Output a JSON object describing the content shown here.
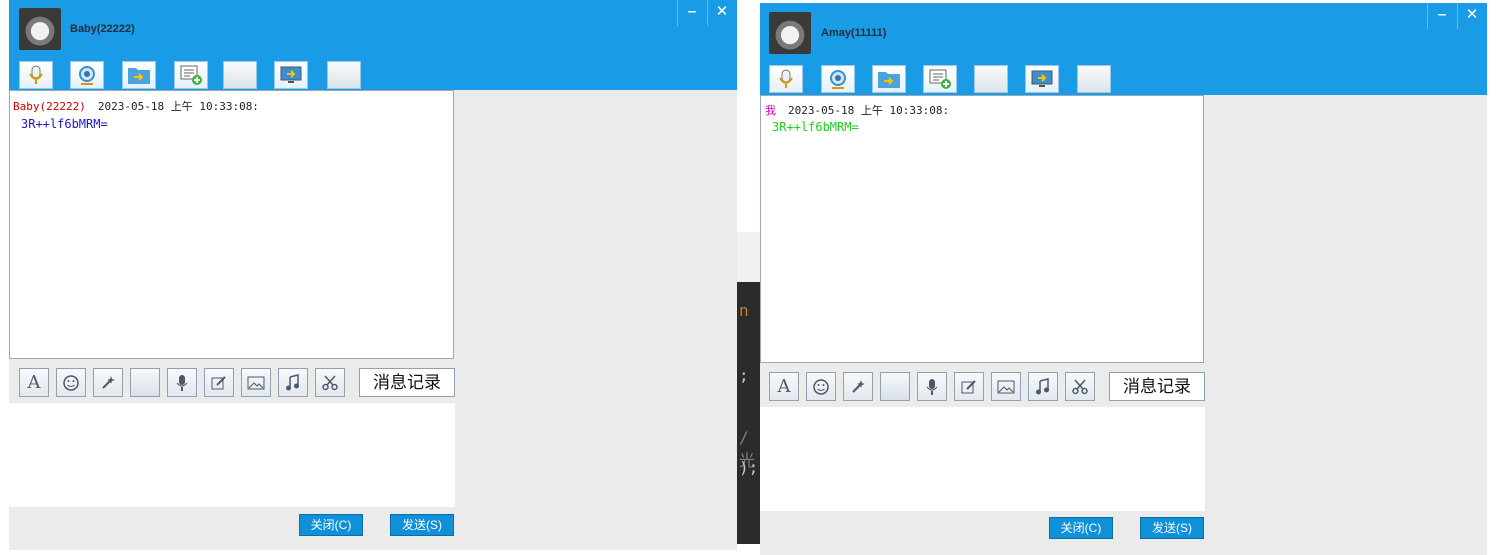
{
  "background_editor": {
    "lines": [
      "n",
      ";",
      "/光",
      ");"
    ]
  },
  "windows": [
    {
      "contact_name": "Baby(22222)",
      "minimize_label": "–",
      "close_label": "✕",
      "toolbar_icons": [
        "microphone-icon",
        "webcam-icon",
        "send-file-icon",
        "add-note-icon",
        "blank-tool-1",
        "share-screen-icon",
        "blank-tool-2"
      ],
      "message": {
        "sender": "Baby(22222)",
        "timestamp": "2023-05-18 上午 10:33:08:",
        "text": "3R++lf6bMRM=",
        "sender_color": "#cc0000",
        "text_color": "#1a1acc"
      },
      "format_icons": [
        "font-icon",
        "emoji-icon",
        "magic-icon",
        "blank",
        "microphone-icon",
        "edit-icon",
        "image-icon",
        "music-icon",
        "scissors-icon"
      ],
      "history_label": "消息记录",
      "close_button_label": "关闭(C)",
      "send_button_label": "发送(S)"
    },
    {
      "contact_name": "Amay(11111)",
      "minimize_label": "–",
      "close_label": "✕",
      "toolbar_icons": [
        "microphone-icon",
        "webcam-icon",
        "send-file-icon",
        "add-note-icon",
        "blank-tool-1",
        "share-screen-icon",
        "blank-tool-2"
      ],
      "message": {
        "sender": "我",
        "timestamp": "2023-05-18 上午 10:33:08:",
        "text": "3R++lf6bMRM=",
        "sender_color": "#cc00cc",
        "text_color": "#22cc22"
      },
      "format_icons": [
        "font-icon",
        "emoji-icon",
        "magic-icon",
        "blank",
        "microphone-icon",
        "edit-icon",
        "image-icon",
        "music-icon",
        "scissors-icon"
      ],
      "history_label": "消息记录",
      "close_button_label": "关闭(C)",
      "send_button_label": "发送(S)"
    }
  ],
  "colors": {
    "titlebar": "#1a9be6",
    "action_button": "#0f90d8"
  }
}
